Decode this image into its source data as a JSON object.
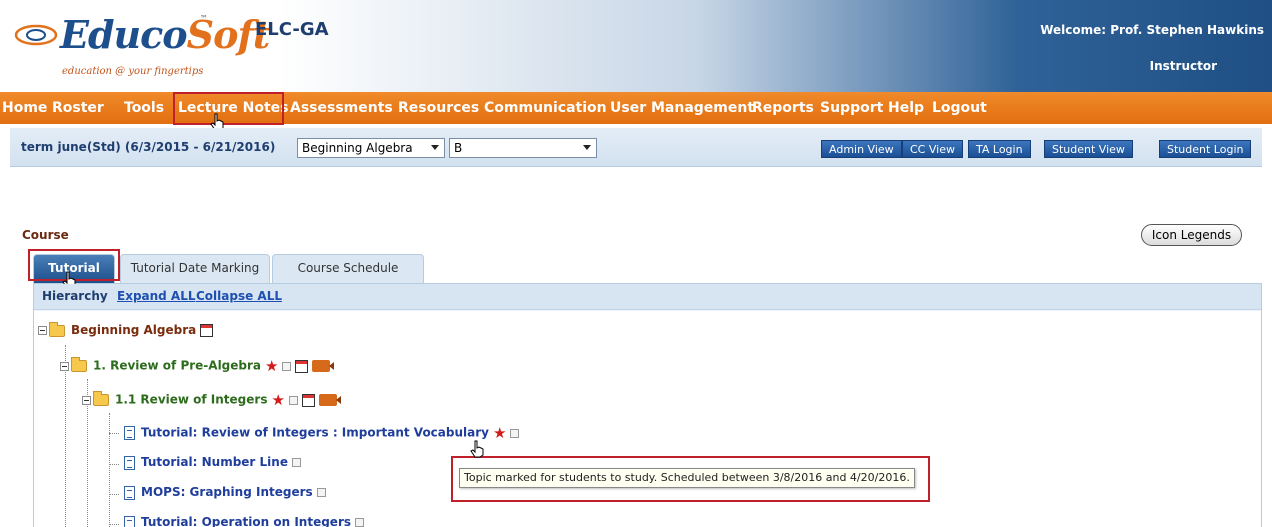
{
  "header": {
    "logo_main": "Educo",
    "logo_accent": "Soft",
    "logo_tm": "™",
    "logo_tagline": "education @ your fingertips",
    "app_title": "ELC-GA",
    "welcome": "Welcome: Prof. Stephen Hawkins",
    "role": "Instructor"
  },
  "nav": {
    "items": [
      "Home",
      "Roster",
      "Tools",
      "Lecture Notes",
      "Assessments",
      "Resources",
      "Communication",
      "User Management",
      "Reports",
      "Support",
      "Help",
      "Logout"
    ],
    "highlighted": "Lecture Notes"
  },
  "subbar": {
    "term": "term june(Std) (6/3/2015 - 6/21/2016)",
    "course_select": "Beginning Algebra",
    "section_select": "B",
    "buttons": [
      "Admin View",
      "CC View",
      "TA Login",
      "Student View",
      "Student Login"
    ]
  },
  "course": {
    "label": "Course",
    "icon_legends": "Icon Legends",
    "tabs": [
      "Tutorial",
      "Tutorial Date Marking",
      "Course Schedule"
    ],
    "active_tab": "Tutorial",
    "hierarchy_label": "Hierarchy",
    "expand_all": "Expand ALL",
    "collapse_all": "Collapse ALL"
  },
  "tree": {
    "root": "Beginning Algebra",
    "chapter": "1. Review of Pre-Algebra",
    "section": "1.1 Review of Integers",
    "leaves": [
      "Tutorial: Review of Integers : Important Vocabulary",
      "Tutorial: Number Line",
      "MOPS: Graphing Integers",
      "Tutorial: Operation on Integers"
    ]
  },
  "tooltip": "Topic marked for students to study. Scheduled between 3/8/2016 and 4/20/2016.",
  "colors": {
    "nav_orange": "#e8791c",
    "highlight_red": "#c0202a",
    "header_blue": "#1f4f84"
  },
  "icons": [
    "folder-icon",
    "document-icon",
    "star-icon",
    "calendar-icon",
    "video-icon",
    "hand-cursor-icon",
    "expander-icon"
  ]
}
